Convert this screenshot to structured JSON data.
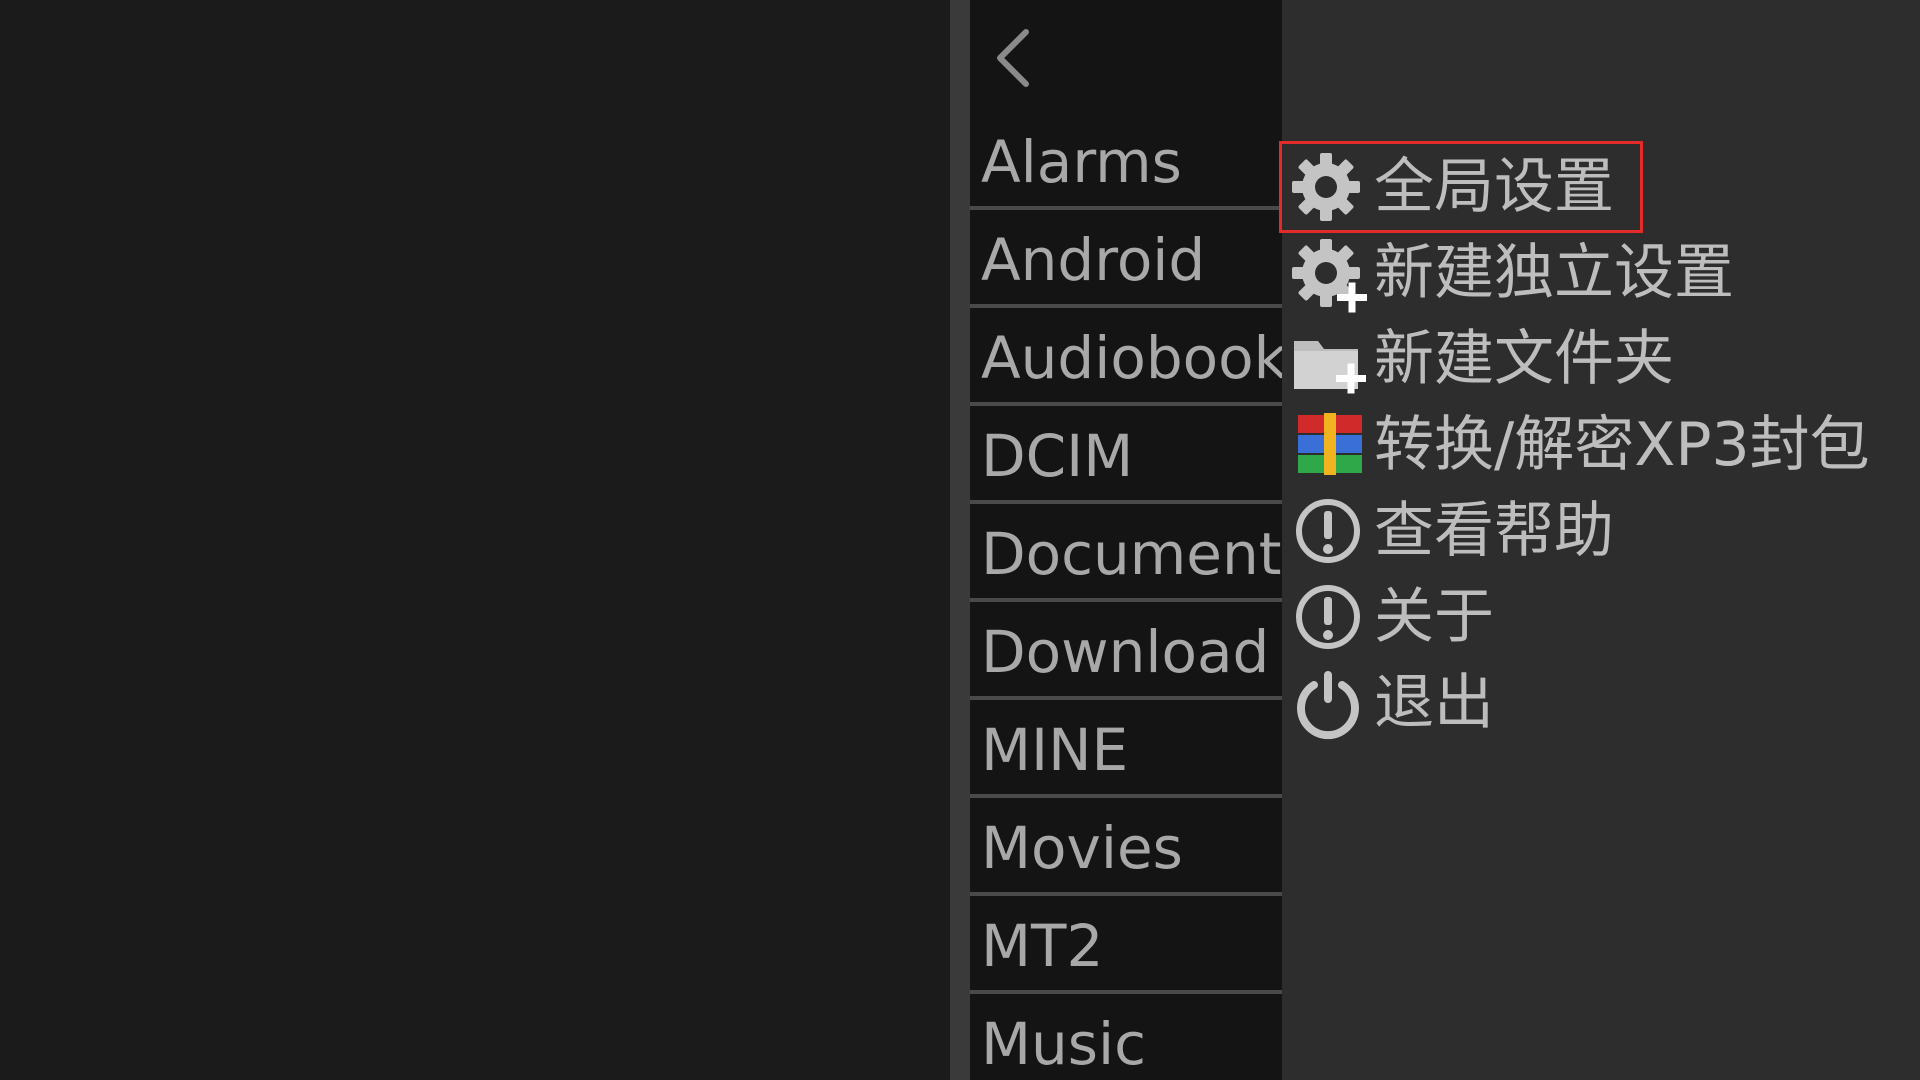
{
  "file_list": {
    "back_icon": "chevron-left-icon",
    "folders": [
      "Alarms",
      "Android",
      "Audiobooks",
      "DCIM",
      "Documents",
      "Download",
      "MINE",
      "Movies",
      "MT2",
      "Music"
    ]
  },
  "menu": {
    "items": [
      {
        "label": "全局设置",
        "icon": "gear-icon",
        "highlighted": true
      },
      {
        "label": "新建独立设置",
        "icon": "gear-plus-icon",
        "highlighted": false
      },
      {
        "label": "新建文件夹",
        "icon": "folder-plus-icon",
        "highlighted": false
      },
      {
        "label": "转换/解密XP3封包",
        "icon": "archive-icon",
        "highlighted": false
      },
      {
        "label": "查看帮助",
        "icon": "exclamation-icon",
        "highlighted": false
      },
      {
        "label": "关于",
        "icon": "exclamation-icon",
        "highlighted": false
      },
      {
        "label": "退出",
        "icon": "power-icon",
        "highlighted": false
      }
    ]
  },
  "colors": {
    "highlight_border": "#e32b2b",
    "text": "#a8a8a8",
    "menu_background": "#2d2d2d"
  }
}
